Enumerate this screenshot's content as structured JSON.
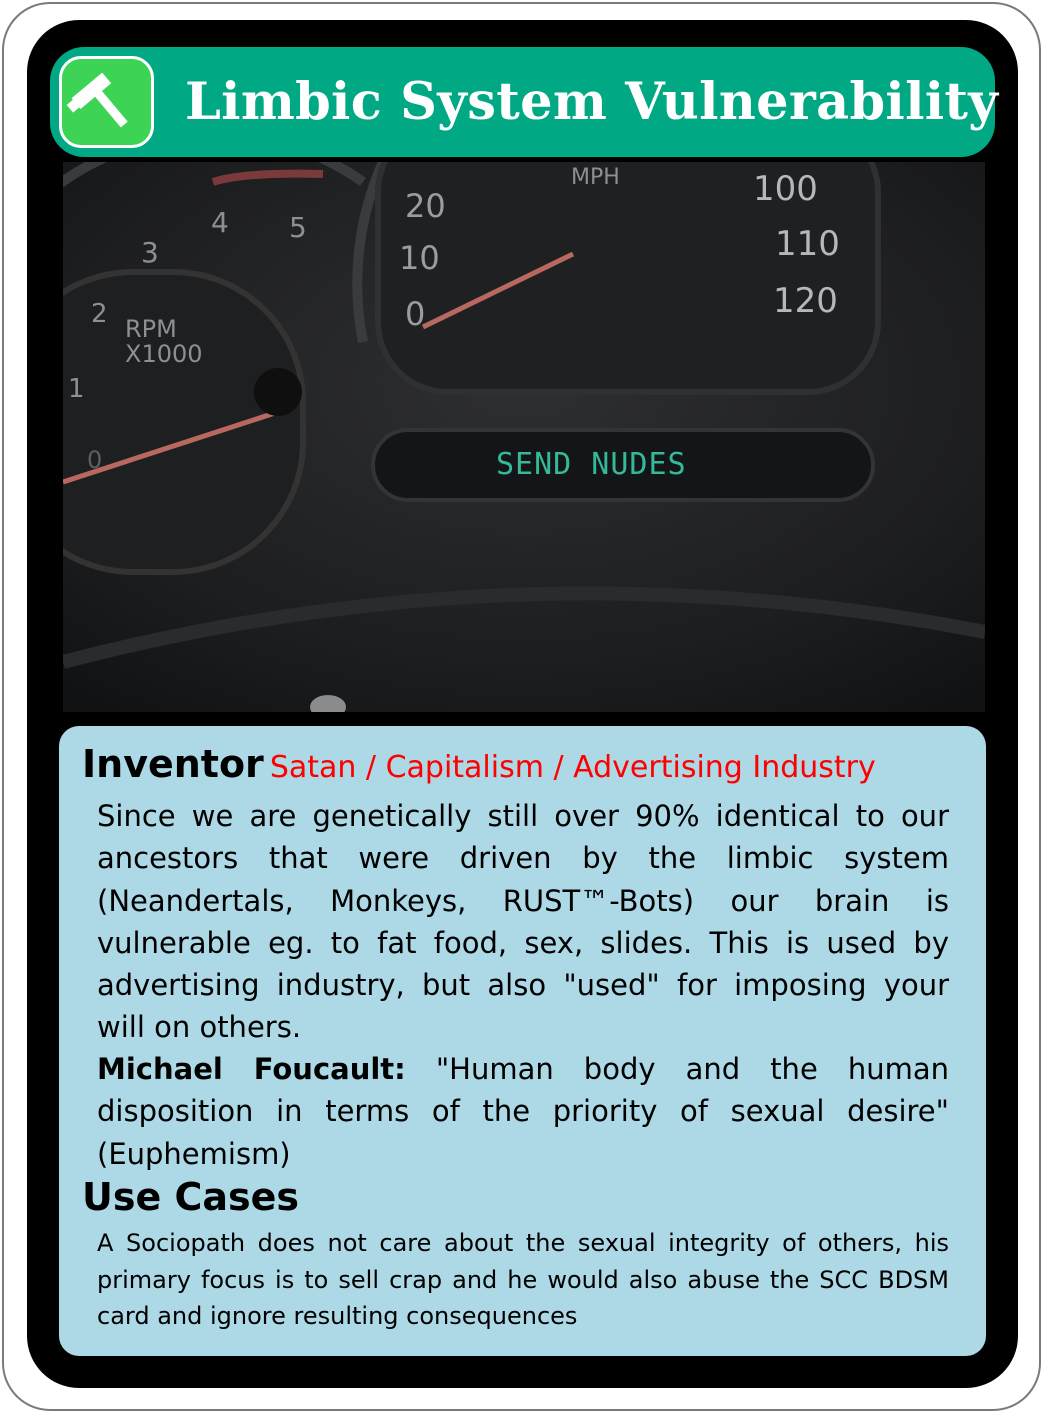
{
  "card": {
    "title": "Limbic System Vulnerability",
    "category_icon": "hammer-icon",
    "colors": {
      "header": "#00a883",
      "icon_badge": "#3dd455",
      "info_panel": "#add8e6",
      "inventor_value": "#ff0000"
    }
  },
  "image": {
    "rpm_label_1": "RPM",
    "rpm_label_2": "X1000",
    "rpm_ticks": [
      "1",
      "2",
      "3",
      "4",
      "5",
      "0"
    ],
    "mph_label": "MPH",
    "speed_ticks_left": [
      "20",
      "10",
      "0"
    ],
    "speed_ticks_right": [
      "100",
      "110",
      "120"
    ],
    "display_text": "SEND NUDES"
  },
  "inventor": {
    "label": "Inventor",
    "value": "Satan / Capitalism / Advertising Industry"
  },
  "description": "Since we are genetically still over 90% identical to our ancestors that were driven by the limbic system (Neandertals, Monkeys, RUST™-Bots) our brain is vulnerable eg. to fat food, sex, slides. This is used by advertising industry, but also \"used\" for imposing your will on others.",
  "quote": {
    "author": "Michael Foucault:",
    "text": " \"Human body and the human disposition in terms of the priority of sexual desire\" (Euphemism)"
  },
  "use_cases": {
    "label": "Use Cases",
    "text": "A Sociopath does not care about the sexual integrity of others, his primary focus is to sell crap and he would also abuse the SCC BDSM card and ignore resulting consequences"
  }
}
